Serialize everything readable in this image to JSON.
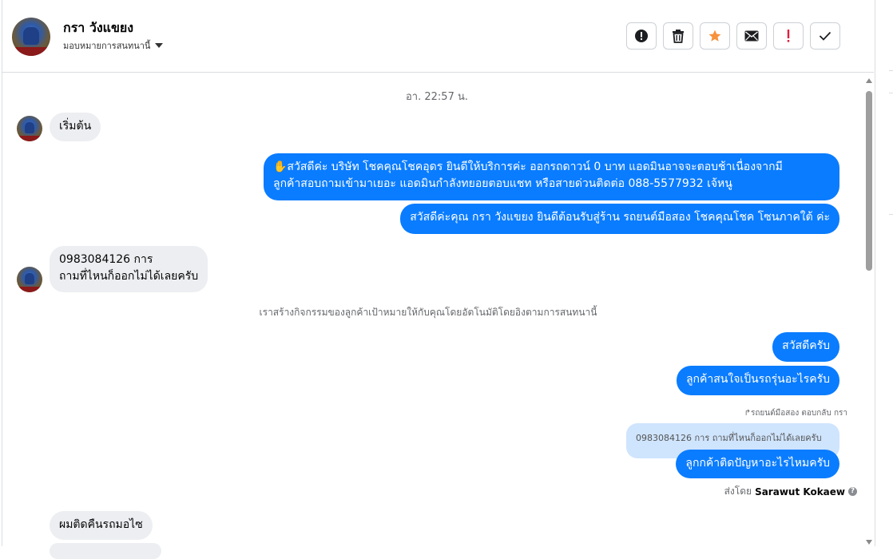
{
  "header": {
    "contact_name": "กรา วังแขยง",
    "assign_label": "มอบหมายการสนทนานี้",
    "actions": [
      {
        "name": "mark-spam-button",
        "icon": "alert-circle-icon"
      },
      {
        "name": "delete-button",
        "icon": "trash-icon"
      },
      {
        "name": "star-button",
        "icon": "star-icon",
        "color": "#f7923b"
      },
      {
        "name": "email-button",
        "icon": "envelope-icon"
      },
      {
        "name": "important-button",
        "icon": "exclamation-icon",
        "color": "#e41e3f"
      },
      {
        "name": "done-button",
        "icon": "check-icon"
      }
    ]
  },
  "conversation": {
    "timestamp": "อา. 22:57 น.",
    "msg_in_1": "เริ่มต้น",
    "msg_out_1_line1": "✋สวัสดีค่ะ บริษัท โชคคุณโชคอุดร ยินดีให้บริการค่ะ ออกรถดาวน์ 0 บาท แอดมินอาจจะตอบช้าเนื่องจากมี",
    "msg_out_1_line2": "ลูกค้าสอบถามเข้ามาเยอะ แอดมินกำลังทยอยตอบแชท หรือสายด่วนติดต่อ 088-5577932 เจ้หนู",
    "msg_out_2": "สวัสดีค่ะคุณ กรา วังแขยง ยินดีต้อนรับสู่ร้าน รถยนต์มือสอง โชคคุณโชค โซนภาคใต้ ค่ะ",
    "msg_in_2_line1": "0983084126 การ",
    "msg_in_2_line2": "ถามที่ไหนก็ออกไม่ได้เลยครับ",
    "system_note": "เราสร้างกิจกรรมของลูกค้าเป้าหมายให้กับคุณโดยอัตโนมัติโดยอิงตามการสนทนานี้",
    "msg_out_3": "สวัสดีครับ",
    "msg_out_4": "ลูกค้าสนใจเป็นรถรุ่นอะไรครับ",
    "reply_note": "↱รถยนต์มือสอง ตอบกลับ กรา",
    "reply_quote": "0983084126 การ ถามที่ไหนก็ออกไม่ได้เลยครับ",
    "msg_out_5": "ลูกกค้าติดปัญหาอะไรไหมครับ",
    "sent_by_prefix": "ส่งโดย",
    "sent_by_name": "Sarawut Kokaew",
    "msg_in_3": "ผมติดคืนรถมอไซ"
  },
  "colors": {
    "outgoing_bubble": "#0a7cff",
    "incoming_bubble": "#eceef1",
    "reply_quote_bg": "#cfe4fd"
  }
}
